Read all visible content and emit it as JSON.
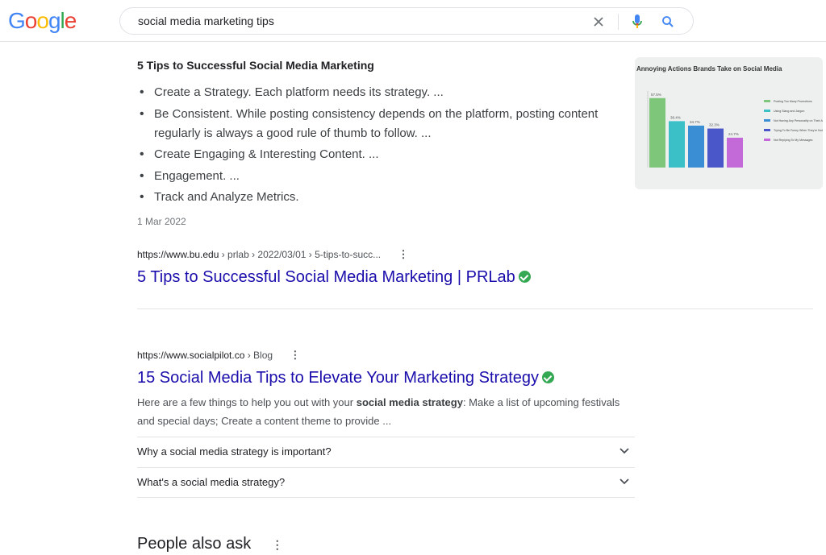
{
  "header": {
    "logo": [
      "G",
      "o",
      "o",
      "g",
      "l",
      "e"
    ],
    "logo_colors": [
      "#4285F4",
      "#EA4335",
      "#FBBC05",
      "#4285F4",
      "#34A853",
      "#EA4335"
    ],
    "search_value": "social media marketing tips"
  },
  "featured_snippet": {
    "title": "5 Tips to Successful Social Media Marketing",
    "items": [
      "Create a Strategy. Each platform needs its strategy. ...",
      "Be Consistent. While posting consistency depends on the platform, posting content regularly is always a good rule of thumb to follow. ...",
      "Create Engaging & Interesting Content. ...",
      "Engagement. ...",
      "Track and Analyze Metrics."
    ],
    "date": "1 Mar 2022",
    "image": {
      "title": "Annoying Actions Brands Take on Social Media",
      "bars": [
        57.5,
        38.4,
        34.7,
        32.3,
        24.7
      ],
      "bar_labels": [
        "57.5%",
        "38.4%",
        "34.7%",
        "32.3%",
        "24.7%"
      ],
      "bar_colors": [
        "#7ec77a",
        "#3cc0c8",
        "#3a8fd4",
        "#4a57c8",
        "#c46ad8"
      ],
      "legend": [
        "Posting Too Many Promotions",
        "Using Slang and Jargon",
        "Not Having Any Personality on Their Accounts",
        "Trying To Be Funny When They're Not",
        "Not Replying To My Messages"
      ]
    }
  },
  "results": [
    {
      "url_host": "https://www.bu.edu",
      "url_path": " › prlab › 2022/03/01 › 5-tips-to-succ...",
      "title": "5 Tips to Successful Social Media Marketing | PRLab"
    },
    {
      "url_host": "https://www.socialpilot.co",
      "url_path": " › Blog",
      "title": "15 Social Media Tips to Elevate Your Marketing Strategy",
      "snippet_pre": "Here are a few things to help you out with your ",
      "snippet_bold": "social media strategy",
      "snippet_post": ": Make a list of upcoming festivals and special days; Create a content theme to provide ...",
      "faqs": [
        "Why a social media strategy is important?",
        "What's a social media strategy?"
      ]
    }
  ],
  "people_also_ask": "People also ask",
  "more_glyph": "⋮"
}
